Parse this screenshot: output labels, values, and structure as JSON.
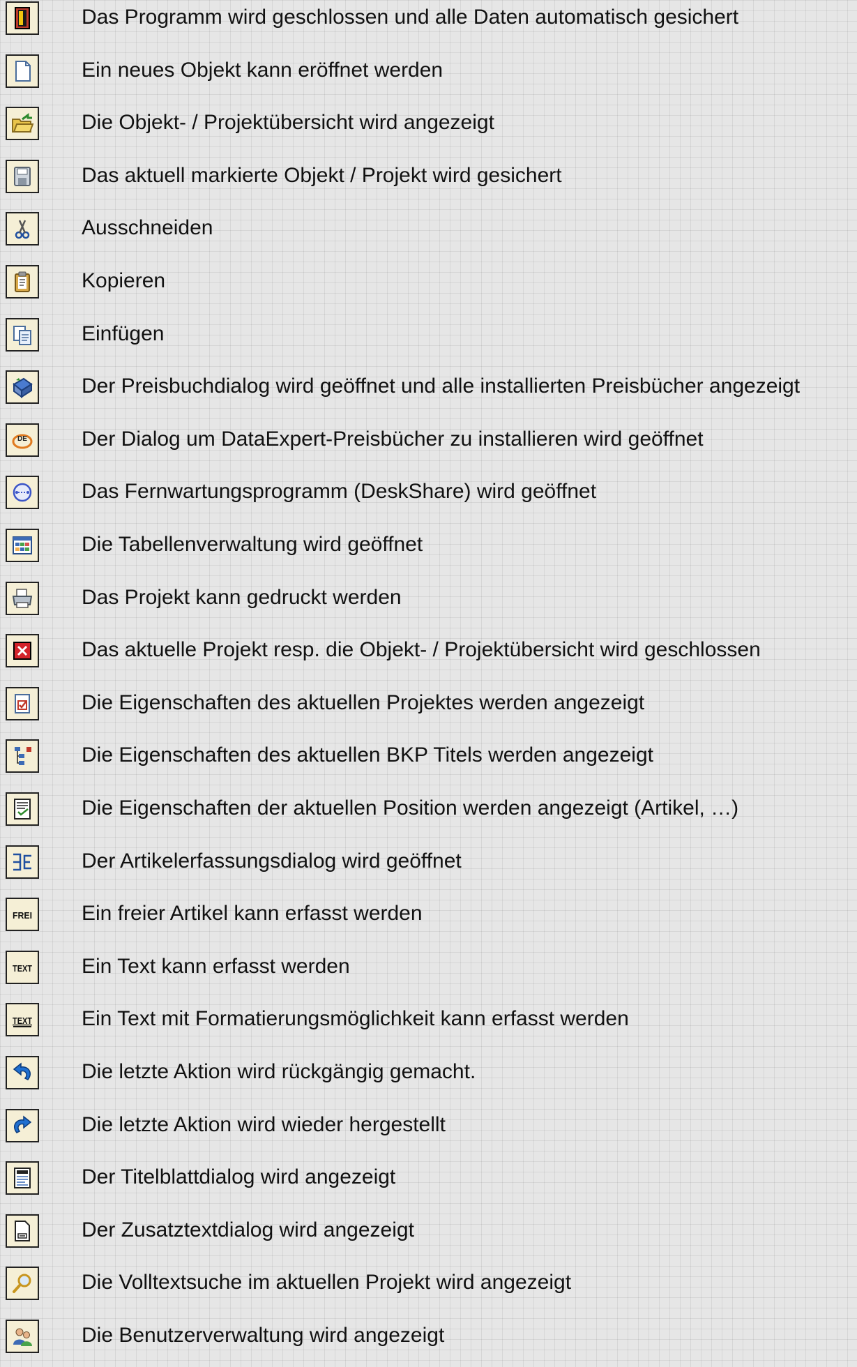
{
  "items": [
    {
      "icon": "exit-door-icon",
      "text": "Das Programm wird geschlossen und alle Daten automatisch gesichert"
    },
    {
      "icon": "new-document-icon",
      "text": "Ein neues Objekt kann eröffnet werden"
    },
    {
      "icon": "open-folder-icon",
      "text": "Die Objekt- / Projektübersicht wird angezeigt"
    },
    {
      "icon": "save-disk-icon",
      "text": "Das aktuell markierte Objekt / Projekt wird gesichert"
    },
    {
      "icon": "scissors-icon",
      "text": "Ausschneiden"
    },
    {
      "icon": "clipboard-icon",
      "text": "Kopieren"
    },
    {
      "icon": "paste-icon",
      "text": "Einfügen"
    },
    {
      "icon": "price-book-icon",
      "text": "Der Preisbuchdialog wird geöffnet und alle installierten Preisbücher angezeigt"
    },
    {
      "icon": "dataexpert-icon",
      "text": "Der Dialog um DataExpert-Preisbücher zu installieren wird geöffnet"
    },
    {
      "icon": "remote-maintenance-icon",
      "text": "Das Fernwartungsprogramm (DeskShare) wird geöffnet"
    },
    {
      "icon": "table-grid-icon",
      "text": "Die Tabellenverwaltung wird geöffnet"
    },
    {
      "icon": "printer-icon",
      "text": "Das Projekt kann gedruckt werden"
    },
    {
      "icon": "close-x-icon",
      "text": "Das aktuelle Projekt resp. die Objekt- / Projektübersicht wird geschlossen"
    },
    {
      "icon": "project-properties-icon",
      "text": "Die Eigenschaften des aktuellen Projektes werden angezeigt"
    },
    {
      "icon": "bkp-tree-icon",
      "text": "Die Eigenschaften des aktuellen BKP Titels werden angezeigt"
    },
    {
      "icon": "position-properties-icon",
      "text": "Die Eigenschaften der aktuellen Position werden angezeigt (Artikel, …)"
    },
    {
      "icon": "article-entry-icon",
      "text": "Der Artikelerfassungsdialog wird geöffnet"
    },
    {
      "icon": "frei-icon",
      "text": "Ein freier Artikel kann erfasst werden",
      "icon_text": "FREI"
    },
    {
      "icon": "text-icon",
      "text": "Ein Text kann erfasst werden",
      "icon_text": "TEXT"
    },
    {
      "icon": "formatted-text-icon",
      "text": "Ein Text mit Formatierungsmöglichkeit kann erfasst werden",
      "icon_text": "TEXT"
    },
    {
      "icon": "undo-icon",
      "text": "Die letzte Aktion wird rückgängig gemacht."
    },
    {
      "icon": "redo-icon",
      "text": "Die letzte Aktion wird wieder hergestellt"
    },
    {
      "icon": "title-page-icon",
      "text": "Der Titelblattdialog wird angezeigt"
    },
    {
      "icon": "additional-text-icon",
      "text": "Der Zusatztextdialog wird angezeigt"
    },
    {
      "icon": "magnifier-icon",
      "text": "Die Volltextsuche im aktuellen Projekt wird angezeigt"
    },
    {
      "icon": "users-icon",
      "text": "Die Benutzerverwaltung wird angezeigt"
    }
  ]
}
